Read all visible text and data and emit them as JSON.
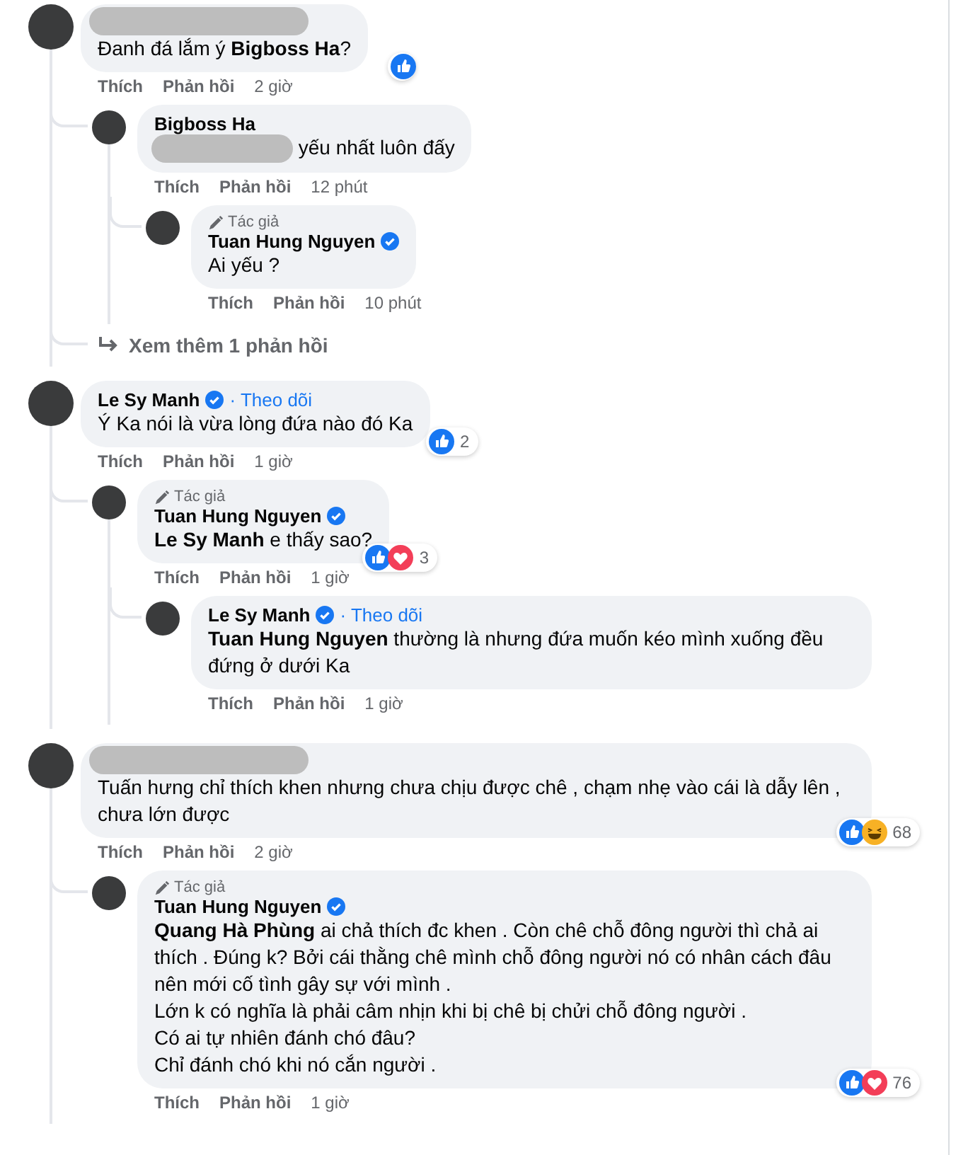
{
  "comments": [
    {
      "author_hidden": true,
      "text": "Đanh đá lắm ý **Bigboss Ha**?",
      "reactions": {
        "icons": [
          {
            "kind": "like"
          }
        ]
      },
      "actions": [
        "Thích",
        "Phản hồi"
      ],
      "time": "2 giờ",
      "replies": [
        {
          "author": "Bigboss Ha",
          "text_hidden_prefix": true,
          "text": "yếu nhất luôn đấy",
          "actions": [
            "Thích",
            "Phản hồi"
          ],
          "time": "12 phút",
          "replies": [
            {
              "author_label": "Tác giả",
              "author": "Tuan Hung Nguyen",
              "verified": true,
              "text": "Ai yếu ?",
              "actions": [
                "Thích",
                "Phản hồi"
              ],
              "time": "10 phút"
            }
          ]
        }
      ],
      "more_replies": "Xem thêm 1 phản hồi"
    },
    {
      "author": "Le Sy Manh",
      "verified": true,
      "follow": "· Theo dõi",
      "text": "Ý Ka nói là vừa lòng đứa nào đó Ka",
      "reactions": {
        "icons": [
          {
            "kind": "like"
          }
        ],
        "count": "2"
      },
      "actions": [
        "Thích",
        "Phản hồi"
      ],
      "time": "1 giờ",
      "replies": [
        {
          "author_label": "Tác giả",
          "author": "Tuan Hung Nguyen",
          "verified": true,
          "text": "**Le Sy Manh** e thấy sao?",
          "reactions": {
            "icons": [
              {
                "kind": "like"
              },
              {
                "kind": "love"
              }
            ],
            "count": "3"
          },
          "actions": [
            "Thích",
            "Phản hồi"
          ],
          "time": "1 giờ",
          "replies": [
            {
              "author": "Le Sy Manh",
              "verified": true,
              "follow": "· Theo dõi",
              "text": "**Tuan Hung Nguyen** thường là nhưng đứa muốn kéo mình xuống đều đứng ở dưới Ka",
              "actions": [
                "Thích",
                "Phản hồi"
              ],
              "time": "1 giờ"
            }
          ]
        }
      ]
    },
    {
      "author_hidden": true,
      "text": "Tuấn hưng chỉ thích khen nhưng chưa chịu được chê , chạm nhẹ vào cái là dẫy lên , chưa lớn được",
      "reactions": {
        "icons": [
          {
            "kind": "like"
          },
          {
            "kind": "haha"
          }
        ],
        "count": "68"
      },
      "actions": [
        "Thích",
        "Phản hồi"
      ],
      "time": "2 giờ",
      "replies": [
        {
          "author_label": "Tác giả",
          "author": "Tuan Hung Nguyen",
          "verified": true,
          "text": "**Quang Hà Phùng** ai chả thích đc khen . Còn chê chỗ đông người thì chả ai thích . Đúng k? Bởi cái thằng chê mình chỗ đông người nó có nhân cách đâu nên mới cố tình gây sự với mình .\nLớn k có nghĩa là phải câm nhịn khi bị chê bị chửi chỗ đông người .\nCó ai tự nhiên đánh chó đâu?\nChỉ đánh chó khi nó cắn người .",
          "reactions": {
            "icons": [
              {
                "kind": "like"
              },
              {
                "kind": "love"
              }
            ],
            "count": "76"
          },
          "actions": [
            "Thích",
            "Phản hồi"
          ],
          "time": "1 giờ"
        }
      ]
    }
  ]
}
